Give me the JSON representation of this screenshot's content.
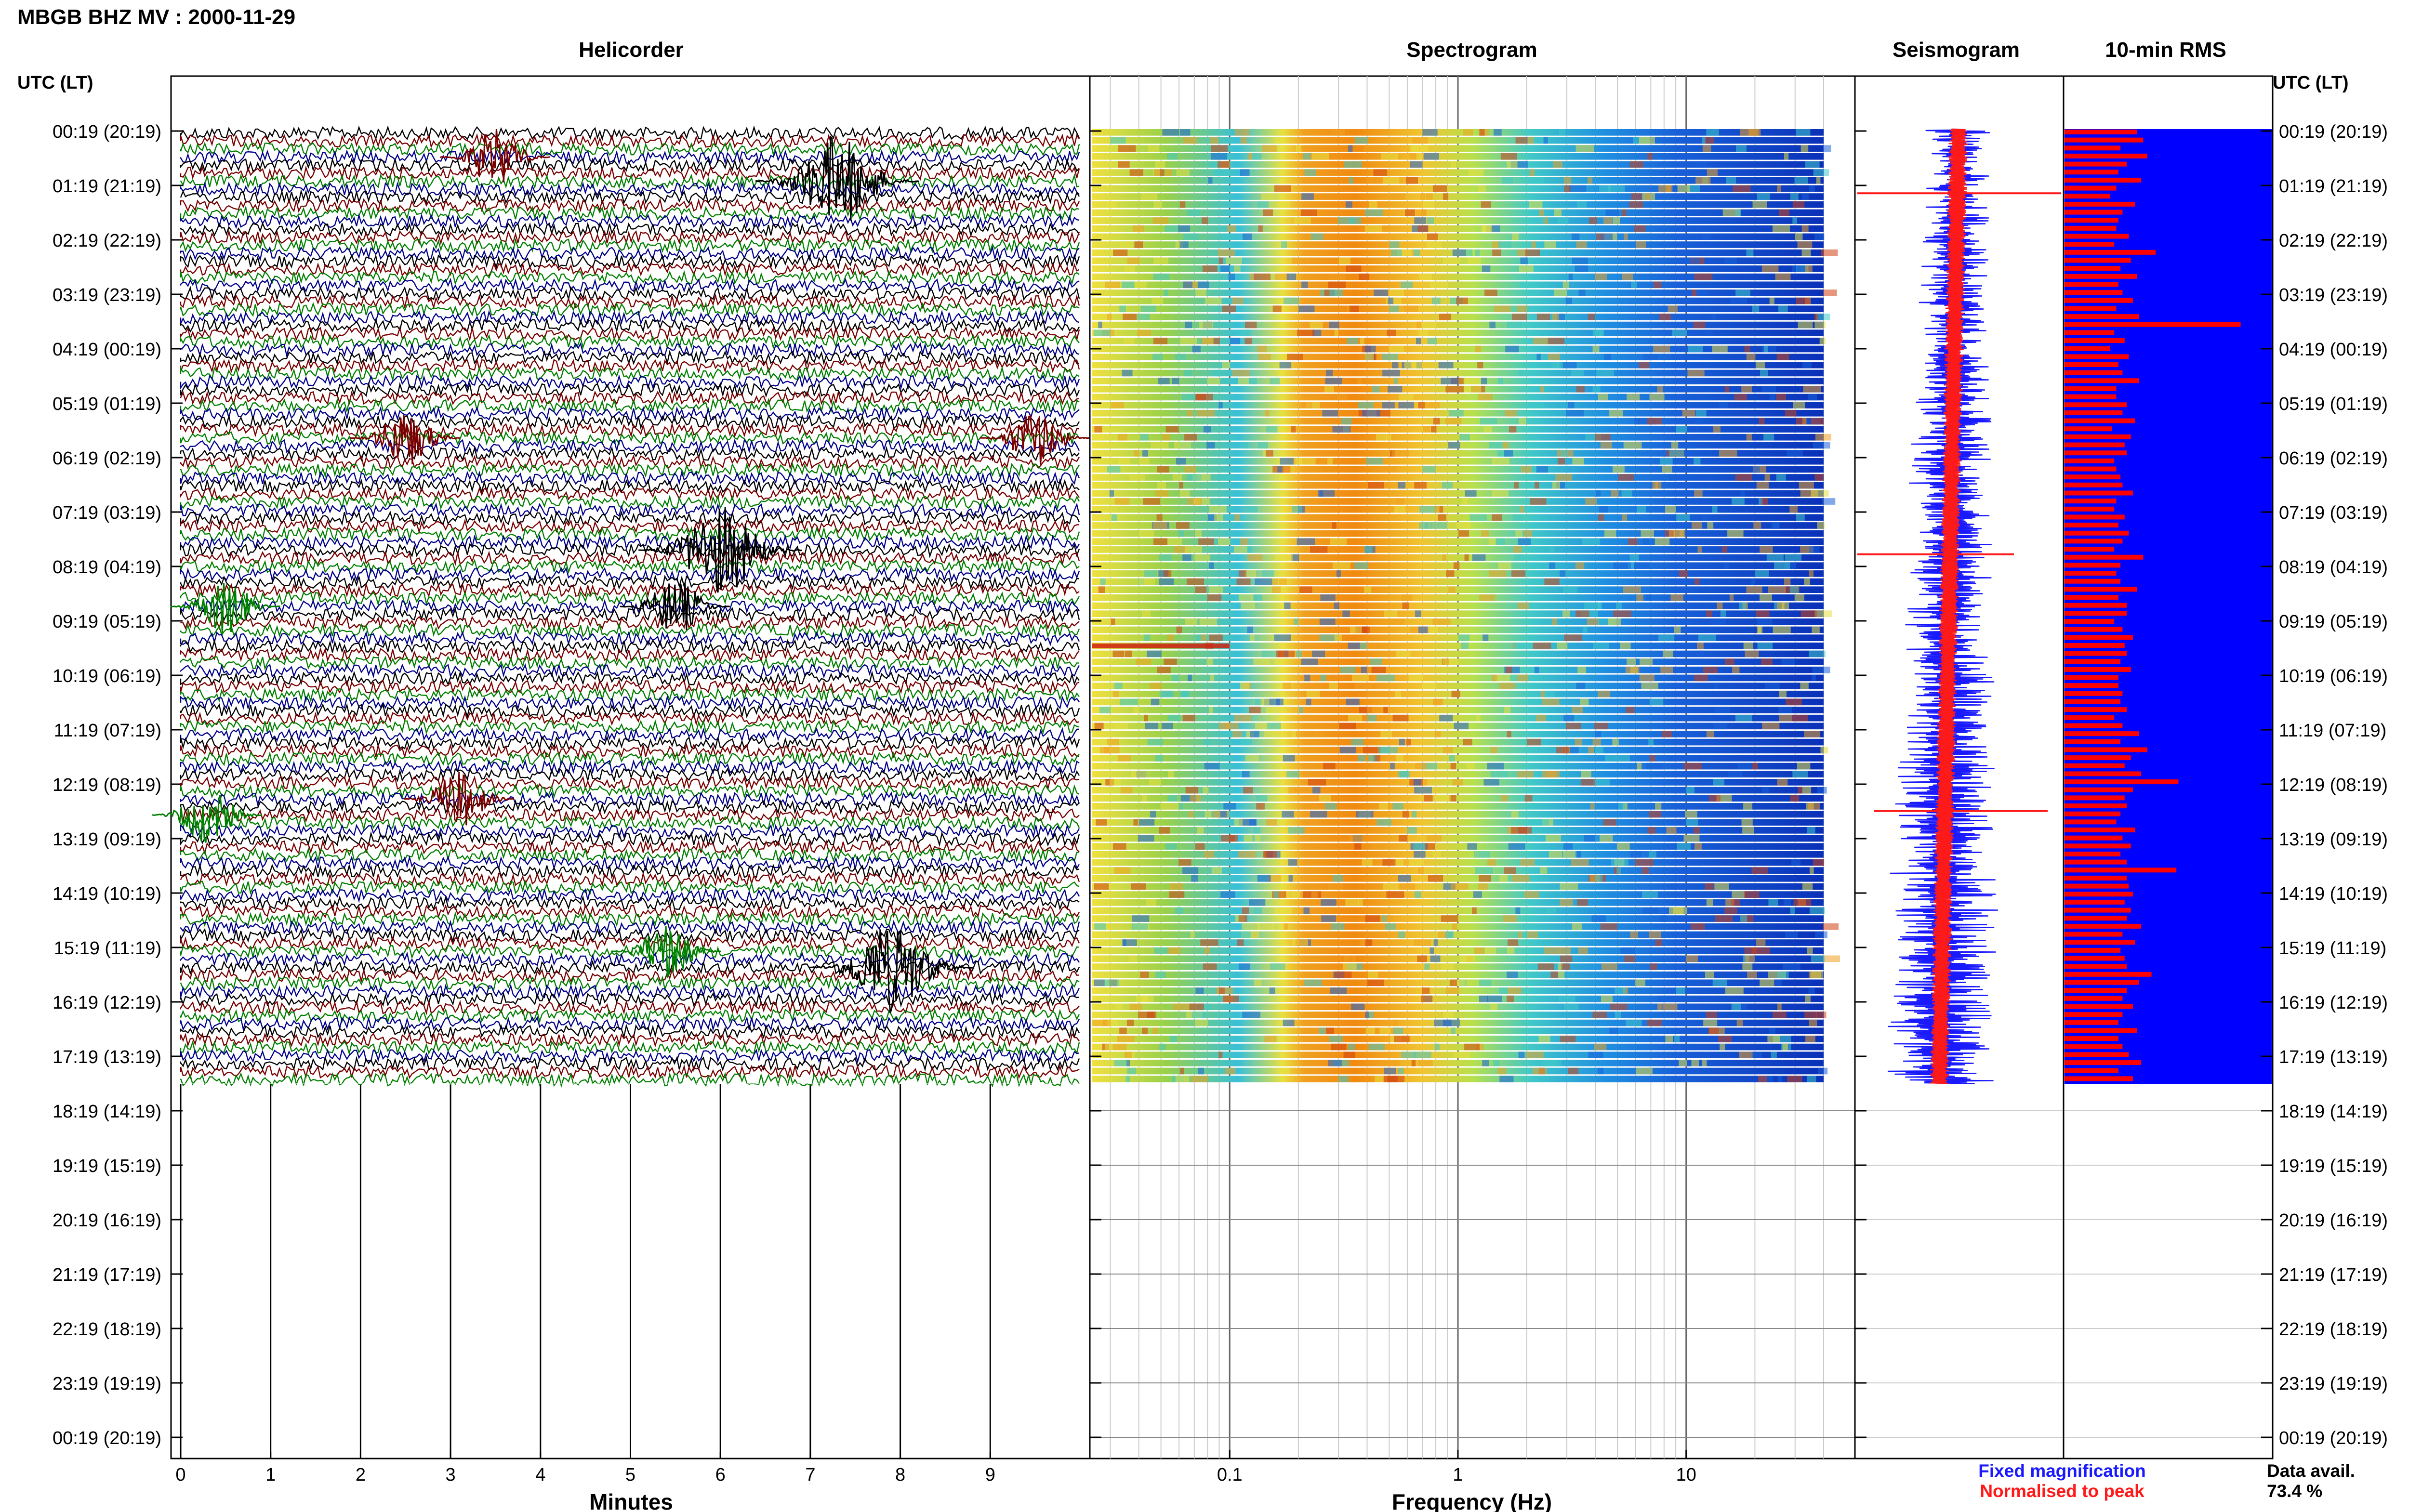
{
  "page_title": "MBGB BHZ MV : 2000-11-29",
  "panels": {
    "helicorder": "Helicorder",
    "spectrogram": "Spectrogram",
    "seismogram": "Seismogram",
    "rms": "10-min RMS"
  },
  "time_axis_title": "UTC (LT)",
  "time_labels": [
    "00:19 (20:19)",
    "01:19 (21:19)",
    "02:19 (22:19)",
    "03:19 (23:19)",
    "04:19 (00:19)",
    "05:19 (01:19)",
    "06:19 (02:19)",
    "07:19 (03:19)",
    "08:19 (04:19)",
    "09:19 (05:19)",
    "10:19 (06:19)",
    "11:19 (07:19)",
    "12:19 (08:19)",
    "13:19 (09:19)",
    "14:19 (10:19)",
    "15:19 (11:19)",
    "16:19 (12:19)",
    "17:19 (13:19)",
    "18:19 (14:19)",
    "19:19 (15:19)",
    "20:19 (16:19)",
    "21:19 (17:19)",
    "22:19 (18:19)",
    "23:19 (19:19)",
    "00:19 (20:19)"
  ],
  "minutes_axis": {
    "label": "Minutes",
    "ticks": [
      "0",
      "1",
      "2",
      "3",
      "4",
      "5",
      "6",
      "7",
      "8",
      "9"
    ]
  },
  "frequency_axis": {
    "label": "Frequency (Hz)",
    "ticks": [
      "0.1",
      "1",
      "10"
    ],
    "scale": "log"
  },
  "legend": {
    "fixed": {
      "label": "Fixed magnification",
      "color": "#1a1aff"
    },
    "normalised": {
      "label": "Normalised to peak",
      "color": "#ff1a1a"
    }
  },
  "data_availability": {
    "label": "Data avail.",
    "value": "73.4 %"
  },
  "colors": {
    "trace_cycle": [
      "#000000",
      "#7a0000",
      "#008000",
      "#00008b"
    ],
    "spectrogram_cmap": "jet",
    "rms_bar": "#ff0000",
    "rms_background": "#0000ff"
  },
  "chart_data": [
    {
      "type": "line",
      "title": "Helicorder",
      "xlabel": "Minutes",
      "xlim": [
        0,
        10
      ],
      "rows": "10-minute traces from 00:19 to 18:19 UTC",
      "events": [
        {
          "time": "01:19",
          "minute": 7.3,
          "color": "black",
          "size": "large"
        },
        {
          "time": "08:59",
          "minute": 6.0,
          "color": "black",
          "size": "large"
        },
        {
          "time": "10:09",
          "minute": 5.5,
          "color": "black",
          "size": "medium"
        },
        {
          "time": "00:49",
          "minute": 3.5,
          "color": "dark-red",
          "size": "medium"
        },
        {
          "time": "06:39",
          "minute": 2.5,
          "color": "dark-red",
          "size": "medium"
        },
        {
          "time": "06:39",
          "minute": 9.5,
          "color": "dark-red",
          "size": "medium"
        },
        {
          "time": "14:09",
          "minute": 3.1,
          "color": "dark-red",
          "size": "medium"
        },
        {
          "time": "17:19",
          "minute": 5.4,
          "color": "green",
          "size": "medium"
        },
        {
          "time": "17:39",
          "minute": 7.9,
          "color": "black",
          "size": "large"
        },
        {
          "time": "14:29",
          "minute": 0.3,
          "color": "green",
          "size": "medium"
        },
        {
          "time": "10:09",
          "minute": 0.5,
          "color": "green",
          "size": "medium"
        }
      ]
    },
    {
      "type": "heatmap",
      "title": "Spectrogram",
      "xlabel": "Frequency (Hz)",
      "x_scale": "log",
      "xlim": [
        0.025,
        40
      ],
      "dominant_band_hz": [
        0.2,
        0.6
      ],
      "rows": "10-minute windows from 00:19 to 18:19 UTC"
    },
    {
      "type": "bar",
      "title": "10-min RMS",
      "orientation": "horizontal",
      "notes": "relative RMS per 10-minute window (fraction of panel width)",
      "values": [
        0.35,
        0.38,
        0.27,
        0.4,
        0.3,
        0.26,
        0.37,
        0.25,
        0.22,
        0.34,
        0.28,
        0.26,
        0.25,
        0.31,
        0.24,
        0.44,
        0.32,
        0.27,
        0.35,
        0.26,
        0.28,
        0.33,
        0.25,
        0.36,
        0.85,
        0.24,
        0.29,
        0.22,
        0.31,
        0.26,
        0.28,
        0.36,
        0.25,
        0.25,
        0.3,
        0.28,
        0.34,
        0.23,
        0.32,
        0.29,
        0.3,
        0.24,
        0.25,
        0.27,
        0.28,
        0.33,
        0.25,
        0.24,
        0.29,
        0.26,
        0.31,
        0.28,
        0.24,
        0.38,
        0.27,
        0.25,
        0.27,
        0.35,
        0.26,
        0.3,
        0.3,
        0.24,
        0.28,
        0.33,
        0.29,
        0.3,
        0.27,
        0.32,
        0.26,
        0.26,
        0.28,
        0.27,
        0.3,
        0.24,
        0.28,
        0.36,
        0.27,
        0.4,
        0.32,
        0.29,
        0.37,
        0.55,
        0.33,
        0.29,
        0.3,
        0.27,
        0.25,
        0.34,
        0.28,
        0.32,
        0.27,
        0.3,
        0.54,
        0.3,
        0.31,
        0.33,
        0.29,
        0.32,
        0.3,
        0.37,
        0.28,
        0.34,
        0.27,
        0.29,
        0.3,
        0.42,
        0.36,
        0.3,
        0.28,
        0.33,
        0.28,
        0.26,
        0.35,
        0.26,
        0.28,
        0.31,
        0.37,
        0.26,
        0.33
      ]
    }
  ]
}
